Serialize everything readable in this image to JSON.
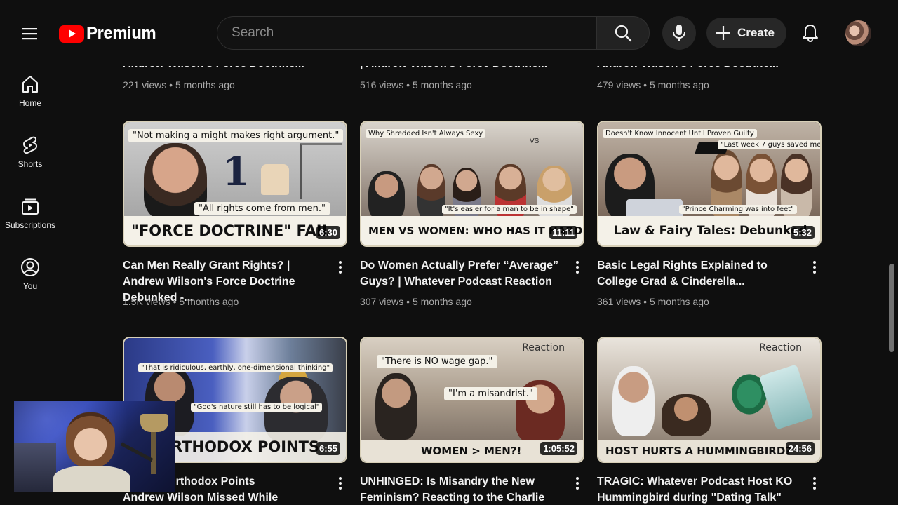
{
  "header": {
    "brand": "Premium",
    "search_placeholder": "Search",
    "create_label": "Create"
  },
  "sidebar": {
    "items": [
      {
        "label": "Home",
        "icon": "home-icon"
      },
      {
        "label": "Shorts",
        "icon": "shorts-icon"
      },
      {
        "label": "Subscriptions",
        "icon": "subscriptions-icon"
      },
      {
        "label": "You",
        "icon": "you-icon"
      }
    ]
  },
  "partial_row": [
    {
      "title": "Andrew Wilson's Force Doctrine...",
      "views": "221 views",
      "age": "5 months ago"
    },
    {
      "title": "| Andrew Wilson's Force Doctrine...",
      "views": "516 views",
      "age": "5 months ago"
    },
    {
      "title": "Andrew Wilson's Force Doctrine...",
      "views": "479 views",
      "age": "5 months ago"
    }
  ],
  "videos": [
    {
      "title": "Can Men Really Grant Rights? | Andrew Wilson's Force Doctrine Debunked -...",
      "views": "1.5K views",
      "age": "5 months ago",
      "duration": "6:30",
      "thumb_text": "\"FORCE DOCTRINE\" FAIL",
      "quotes": [
        "\"Not making a might makes right argument.\"",
        "\"All rights come from men.\""
      ],
      "big_number": "1"
    },
    {
      "title": "Do Women Actually Prefer “Average” Guys? | Whatever Podcast Reaction",
      "views": "307 views",
      "age": "5 months ago",
      "duration": "11:11",
      "thumb_text": "MEN VS WOMEN: WHO HAS IT HARDER",
      "quotes": [
        "Why Shredded Isn't Always Sexy",
        "VS",
        "\"It's easier for a man to be in shape\""
      ]
    },
    {
      "title": "Basic Legal Rights Explained to College Grad & Cinderella...",
      "views": "361 views",
      "age": "5 months ago",
      "duration": "5:32",
      "thumb_text": "Law & Fairy Tales: Debunked",
      "quotes": [
        "Doesn't Know Innocent Until Proven Guilty",
        "\"Last week 7 guys saved me out\"",
        "\"Prince Charming was into feet\""
      ]
    },
    {
      "title": "Eastern Orthodox Points",
      "subtitle": "Andrew Wilson Missed While Debatin...",
      "views": "",
      "age": "",
      "duration": "6:55",
      "thumb_text": "ED ORTHODOX POINTS",
      "quotes": [
        "\"That is ridiculous, earthly, one-dimensional thinking\"",
        "\"God's nature still has to be logical\""
      ]
    },
    {
      "title": "UNHINGED: Is Misandry the New Feminism? Reacting to the Charlie Kir...",
      "views": "",
      "age": "",
      "duration": "1:05:52",
      "thumb_text": "WOMEN > MEN?!",
      "tag": "Reaction",
      "quotes": [
        "\"There is NO wage gap.\"",
        "\"I'm a misandrist.\""
      ]
    },
    {
      "title": "TRAGIC: Whatever Podcast Host KO Hummingbird during \"Dating Talk\"",
      "views": "",
      "age": "",
      "duration": "24:56",
      "thumb_text": "HOST HURTS A HUMMINGBIRD?",
      "tag": "Reaction"
    }
  ],
  "colors": {
    "background": "#0f0f0f",
    "brand_red": "#ff0000",
    "text": "#f1f1f1",
    "meta": "#aaaaaa"
  }
}
